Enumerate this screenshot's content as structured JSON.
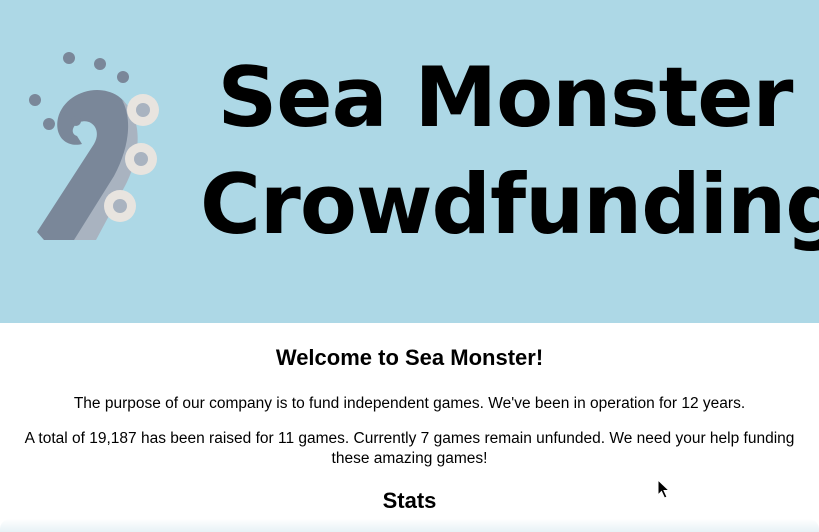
{
  "header": {
    "title": "Sea Monster Crowdfunding",
    "logo_icon": "tentacle-icon",
    "background_color": "#add8e6"
  },
  "main": {
    "welcome_heading": "Welcome to Sea Monster!",
    "purpose_text": "The purpose of our company is to fund independent games. We've been in operation for 12 years.",
    "summary_text": "A total of 19,187 has been raised for 11 games. Currently 7 games remain unfunded. We need your help funding these amazing games!",
    "stats_heading": "Stats"
  },
  "cursor_icon": "mouse-pointer-icon"
}
